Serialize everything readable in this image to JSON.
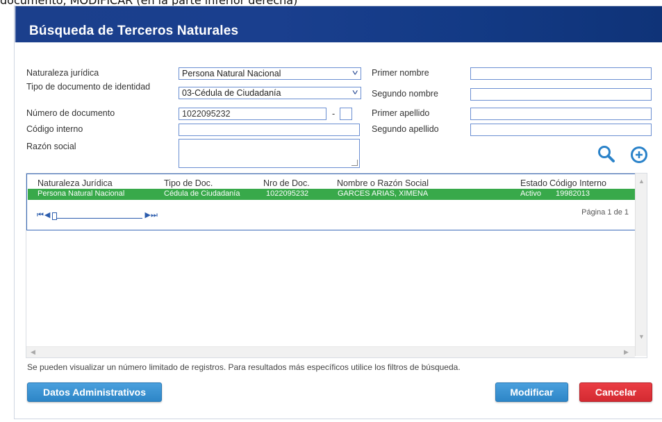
{
  "top_caption": "documento, MODIFICAR (en la parte inferior derecha)",
  "title": "Búsqueda de Terceros Naturales",
  "form": {
    "naturaleza_label": "Naturaleza jurídica",
    "naturaleza_value": "Persona Natural Nacional",
    "tipo_doc_label": "Tipo de documento de identidad",
    "tipo_doc_value": "03-Cédula de Ciudadanía",
    "numero_doc_label": "Número de documento",
    "numero_doc_value": "1022095232",
    "numero_doc_sep": "-",
    "codigo_interno_label": "Código interno",
    "razon_social_label": "Razón social",
    "primer_nombre_label": "Primer nombre",
    "segundo_nombre_label": "Segundo nombre",
    "primer_apellido_label": "Primer apellido",
    "segundo_apellido_label": "Segundo apellido"
  },
  "grid": {
    "headers": [
      "Naturaleza Jurídica",
      "Tipo de Doc.",
      "Nro de Doc.",
      "Nombre o Razón Social",
      "Estado",
      "Código Interno"
    ],
    "rows": [
      [
        "Persona Natural Nacional",
        "Cédula de Ciudadanía",
        "1022095232",
        "GARCES ARIAS, XIMENA",
        "Activo",
        "19982013"
      ]
    ],
    "page_info": "Página 1 de 1"
  },
  "note": "Se pueden visualizar un número limitado de registros. Para resultados más específicos utilice los filtros de búsqueda.",
  "buttons": {
    "datos": "Datos Administrativos",
    "modificar": "Modificar",
    "cancelar": "Cancelar"
  },
  "icons": {
    "search": "search-icon",
    "add": "add-circle-icon"
  },
  "colors": {
    "title_bg": "#1a3f8e",
    "row_selected": "#38a94a",
    "btn_blue": "#2d86c7",
    "btn_red": "#d42a31"
  }
}
